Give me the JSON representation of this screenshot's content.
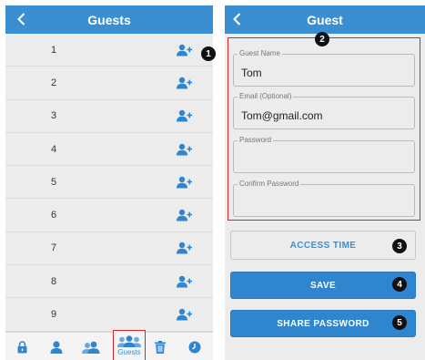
{
  "left_screen": {
    "title": "Guests",
    "guests": [
      "1",
      "2",
      "3",
      "4",
      "5",
      "6",
      "7",
      "8",
      "9"
    ],
    "bottom_nav": {
      "guests_label": "Guests"
    }
  },
  "right_screen": {
    "title": "Guest",
    "fields": {
      "guest_name": {
        "label": "Guest Name",
        "value": "Tom"
      },
      "email": {
        "label": "Email (Optional)",
        "value": "Tom@gmail.com"
      },
      "password": {
        "label": "Password",
        "value": ""
      },
      "confirm_password": {
        "label": "Confirm Password",
        "value": ""
      }
    },
    "buttons": {
      "access_time": "ACCESS TIME",
      "save": "SAVE",
      "share_password": "SHARE PASSWORD"
    }
  },
  "callouts": [
    "1",
    "2",
    "3",
    "4",
    "5"
  ],
  "colors": {
    "primary": "#3a8fd2",
    "button_fill": "#2f86cf",
    "highlight_border": "#d9242b",
    "background": "#ececec"
  }
}
